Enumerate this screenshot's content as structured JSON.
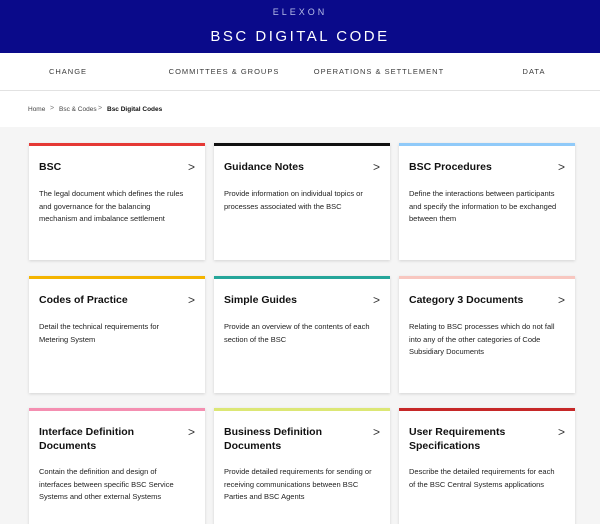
{
  "header": {
    "brand": "ELEXON",
    "title": "BSC DIGITAL CODE"
  },
  "nav": {
    "items": [
      "CHANGE",
      "COMMITTEES & GROUPS",
      "OPERATIONS & SETTLEMENT",
      "DATA"
    ]
  },
  "breadcrumb": {
    "items": [
      "Home",
      "Bsc & Codes",
      "Bsc Digital Codes"
    ],
    "separator": ">"
  },
  "cards": [
    {
      "title": "BSC",
      "description": "The legal document which defines the rules and governance for the balancing mechanism and imbalance settlement",
      "accent": "#e53935",
      "arrow": ">"
    },
    {
      "title": "Guidance Notes",
      "description": "Provide information on individual topics or processes associated with the BSC",
      "accent": "#111111",
      "arrow": ">"
    },
    {
      "title": "BSC Procedures",
      "description": "Define the interactions between participants and specify the information to be exchanged between them",
      "accent": "#90caf9",
      "arrow": ">"
    },
    {
      "title": "Codes of Practice",
      "description": "Detail the technical requirements for Metering System",
      "accent": "#f4b400",
      "arrow": ">"
    },
    {
      "title": "Simple Guides",
      "description": "Provide an overview of the contents of each section of the BSC",
      "accent": "#26a69a",
      "arrow": ">"
    },
    {
      "title": "Category 3 Documents",
      "description": "Relating to BSC processes which do not fall into any of the other categories of Code Subsidiary Documents",
      "accent": "#f8c7c0",
      "arrow": ">"
    },
    {
      "title": "Interface Definition Documents",
      "description": "Contain the definition and design of interfaces between specific BSC Service Systems and other external Systems",
      "accent": "#f48fb1",
      "arrow": ">"
    },
    {
      "title": "Business Definition Documents",
      "description": "Provide detailed requirements for sending or receiving communications between BSC Parties and BSC Agents",
      "accent": "#dce775",
      "arrow": ">"
    },
    {
      "title": "User Requirements Specifications",
      "description": "Describe the detailed requirements for each of the BSC Central Systems applications",
      "accent": "#c62828",
      "arrow": ">"
    }
  ]
}
